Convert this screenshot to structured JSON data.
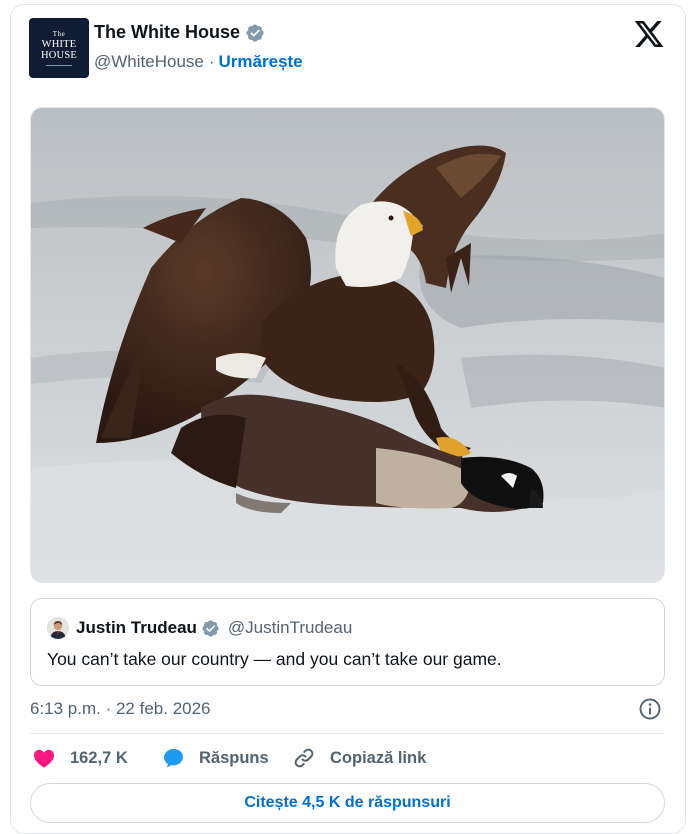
{
  "author": {
    "display_name": "The White House",
    "handle": "@WhiteHouse",
    "separator": "·",
    "follow_label": "Urmărește",
    "avatar_text": {
      "the": "The",
      "line1": "WHITE",
      "line2": "HOUSE"
    },
    "verified_icon": "verified-badge-icon"
  },
  "quote": {
    "display_name": "Justin Trudeau",
    "handle": "@JustinTrudeau",
    "text": "You can’t take our country — and you can’t take our game."
  },
  "timestamp": "6:13 p.m. · 22 feb. 2026",
  "actions": {
    "like_count": "162,7 K",
    "reply_label": "Răspuns",
    "copy_label": "Copiază link"
  },
  "read_replies_label": "Citește 4,5 K de răspunsuri",
  "colors": {
    "link": "#006fd6",
    "like": "#f91880",
    "reply": "#1d9bf0",
    "muted": "#536471",
    "verified": "#829aab"
  }
}
